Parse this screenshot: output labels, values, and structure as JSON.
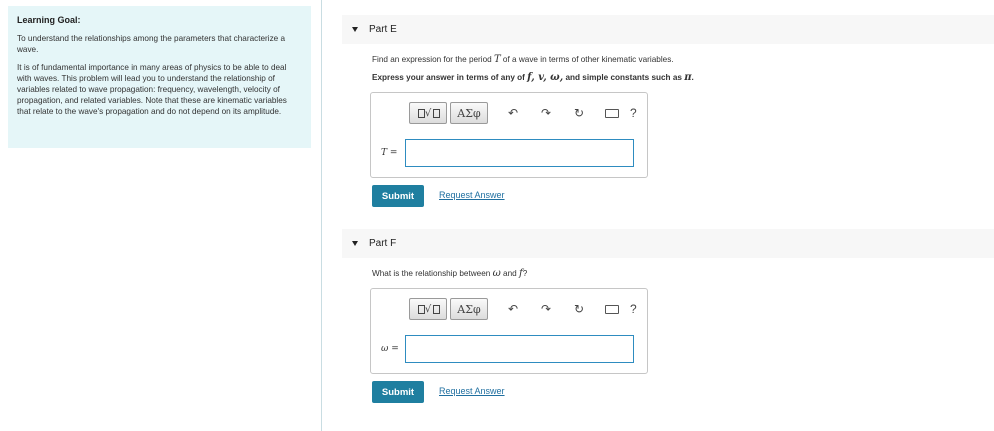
{
  "learning_goal": {
    "title": "Learning Goal:",
    "para1": "To understand the relationships among the parameters that characterize a wave.",
    "para2": "It is of fundamental importance in many areas of physics to be able to deal with waves. This problem will lead you to understand the relationship of variables related to wave propagation: frequency, wavelength, velocity of propagation, and related variables. Note that these are kinematic variables that relate to the wave's propagation and do not depend on its amplitude."
  },
  "parts": [
    {
      "title": "Part E",
      "question_pre": "Find an expression for the period ",
      "question_var": "T",
      "question_post": " of a wave in terms of other kinematic variables.",
      "instruction_pre": "Express your answer in terms of any of ",
      "instruction_vars": "f, v, ω,",
      "instruction_mid": " and simple constants such as ",
      "instruction_const": "π",
      "instruction_end": ".",
      "answer_label": "T =",
      "answer_value": "",
      "submit_label": "Submit",
      "request_label": "Request Answer"
    },
    {
      "title": "Part F",
      "question_pre": "What is the relationship between ",
      "question_var1": "ω",
      "question_mid": " and ",
      "question_var2": "f",
      "question_post": "?",
      "answer_label": "ω =",
      "answer_value": "",
      "submit_label": "Submit",
      "request_label": "Request Answer"
    }
  ],
  "toolbar": {
    "sqrt_label": "√",
    "greek_label": "ΑΣφ",
    "help_label": "?"
  }
}
